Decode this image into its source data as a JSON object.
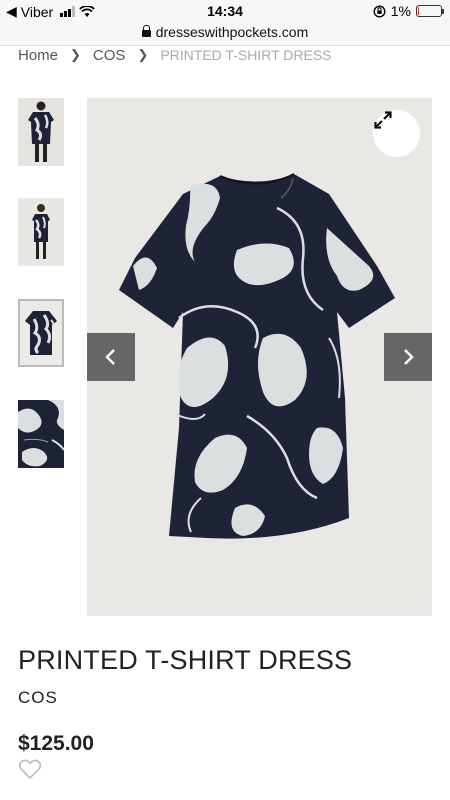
{
  "status_bar": {
    "back_app": "Viber",
    "time": "14:34",
    "battery": "1%",
    "battery_level": 0.01
  },
  "url_bar": {
    "domain": "dresseswithpockets.com"
  },
  "breadcrumb": {
    "items": [
      "Home",
      "COS",
      "PRINTED T-SHIRT DRESS"
    ]
  },
  "gallery": {
    "thumbnails": [
      {
        "icon": "model-back-view-thumbnail"
      },
      {
        "icon": "model-front-view-thumbnail"
      },
      {
        "icon": "dress-flat-thumbnail"
      },
      {
        "icon": "fabric-detail-thumbnail"
      }
    ],
    "active_thumbnail": 3
  },
  "product": {
    "title": "PRINTED T-SHIRT DRESS",
    "brand": "COS",
    "price": "$125.00"
  },
  "colors": {
    "navy": "#1e2236",
    "print_white": "#dcdfe0",
    "background": "#e9e8e4",
    "nav_button": "#666666"
  }
}
